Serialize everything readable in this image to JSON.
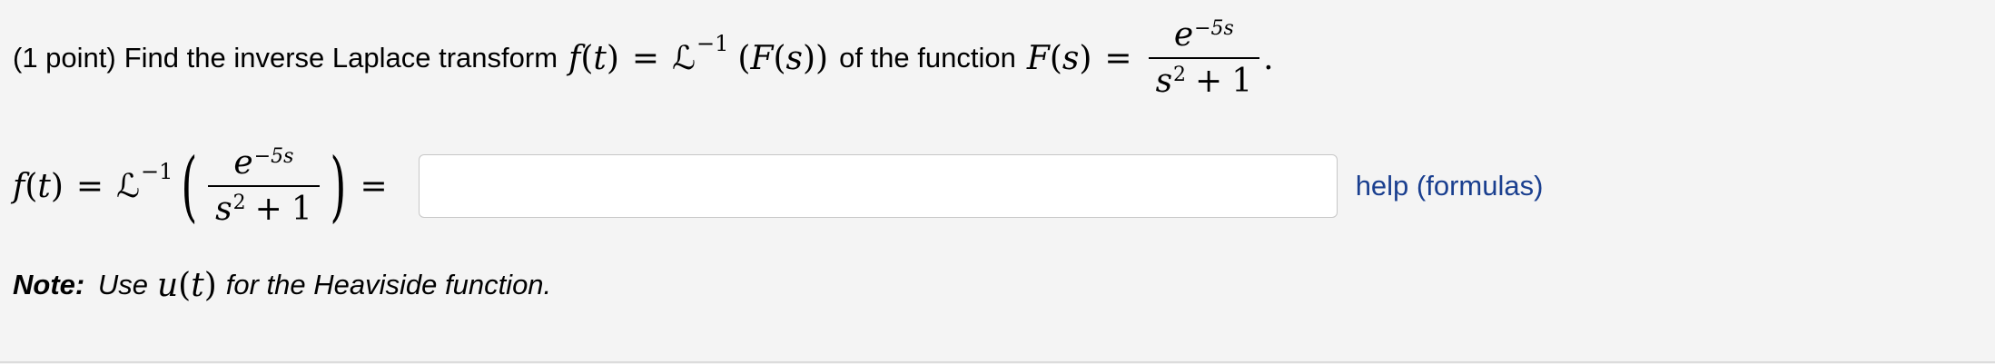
{
  "problem": {
    "points": "(1 point)",
    "instruction": "Find the inverse Laplace transform",
    "connector": "of the function",
    "period": "."
  },
  "math": {
    "f": "f",
    "t": "t",
    "equals": "=",
    "laplace": "ℒ",
    "inverse_sup": "−1",
    "F": "F",
    "s": "s",
    "lparen": "(",
    "rparen": ")",
    "exp_base": "e",
    "exp_power": "−5s",
    "den_base": "s",
    "den_power": "2",
    "plus": "+",
    "one": "1"
  },
  "answer": {
    "value": "",
    "placeholder": ""
  },
  "help": {
    "label": "help (formulas)"
  },
  "note": {
    "label": "Note:",
    "text_before": "Use",
    "u": "u",
    "t": "t",
    "text_after": "for the Heaviside function."
  }
}
